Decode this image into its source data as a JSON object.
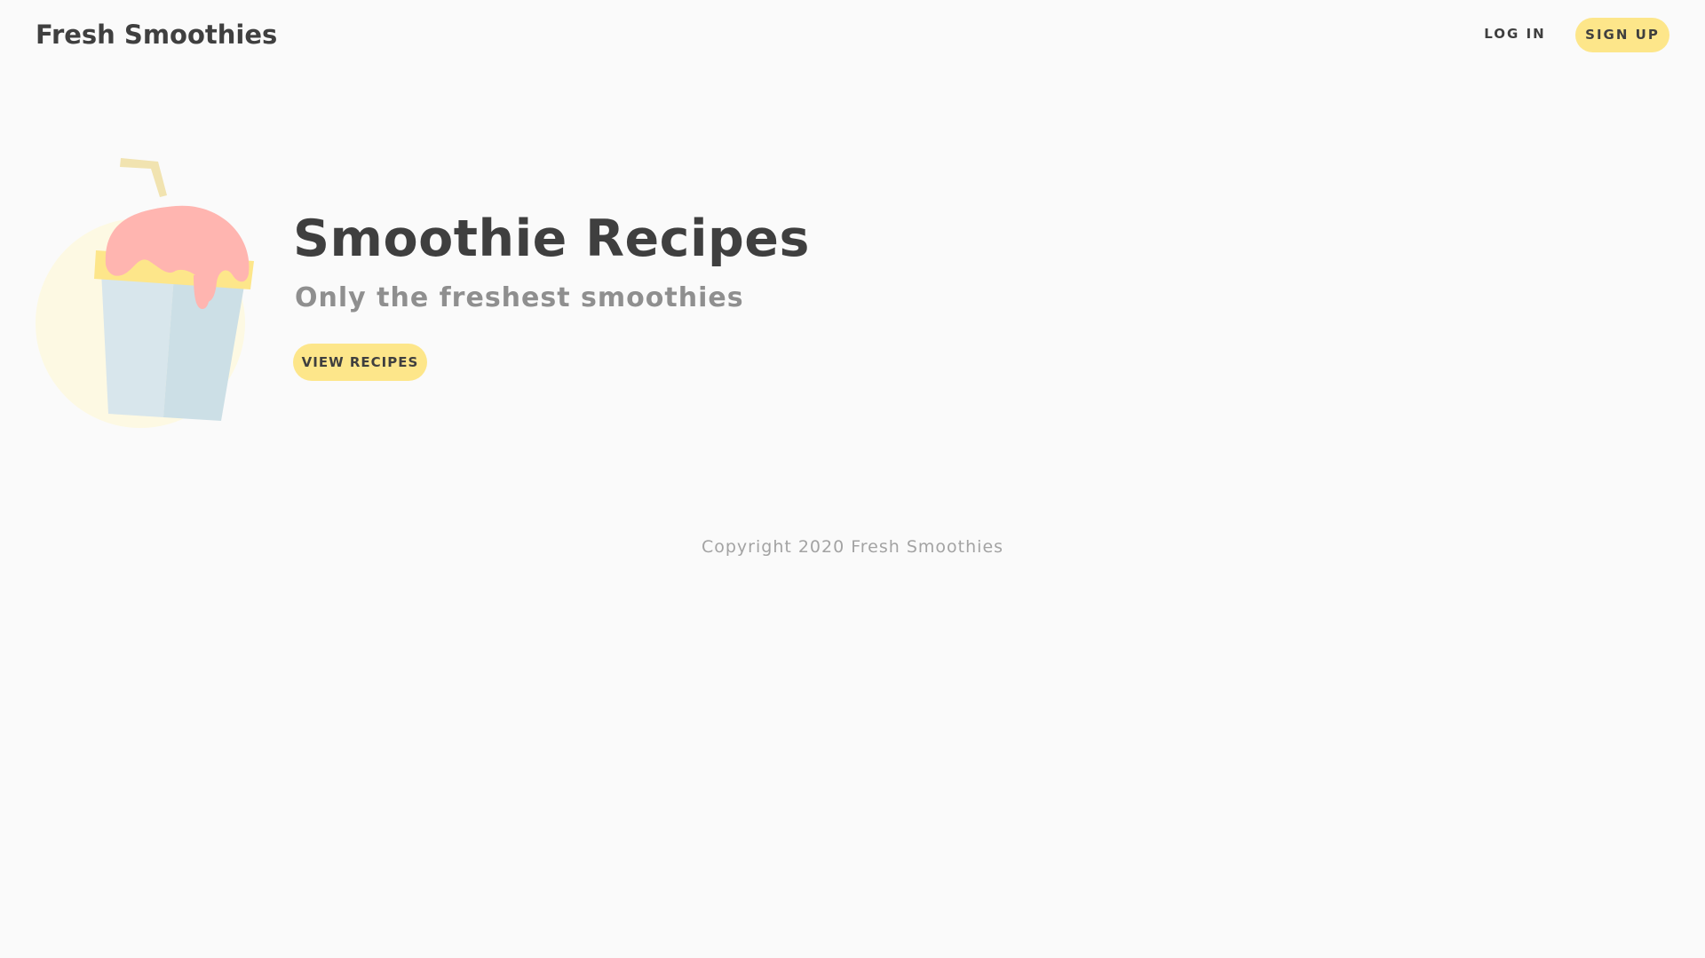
{
  "nav": {
    "brand": "Fresh Smoothies",
    "login_label": "LOG IN",
    "signup_label": "SIGN UP"
  },
  "hero": {
    "title": "Smoothie Recipes",
    "subtitle": "Only the freshest smoothies",
    "cta_label": "VIEW RECIPES",
    "illustration": "smoothie-cup-icon"
  },
  "footer": {
    "copyright": "Copyright 2020 Fresh Smoothies"
  },
  "colors": {
    "background": "#fafafa",
    "accent": "#fde68a",
    "text_dark": "#3f3f3f",
    "text_muted": "#8f8f8f",
    "smoothie_pink": "#ffb5b0",
    "cup_blue": "#d8e6ec"
  }
}
